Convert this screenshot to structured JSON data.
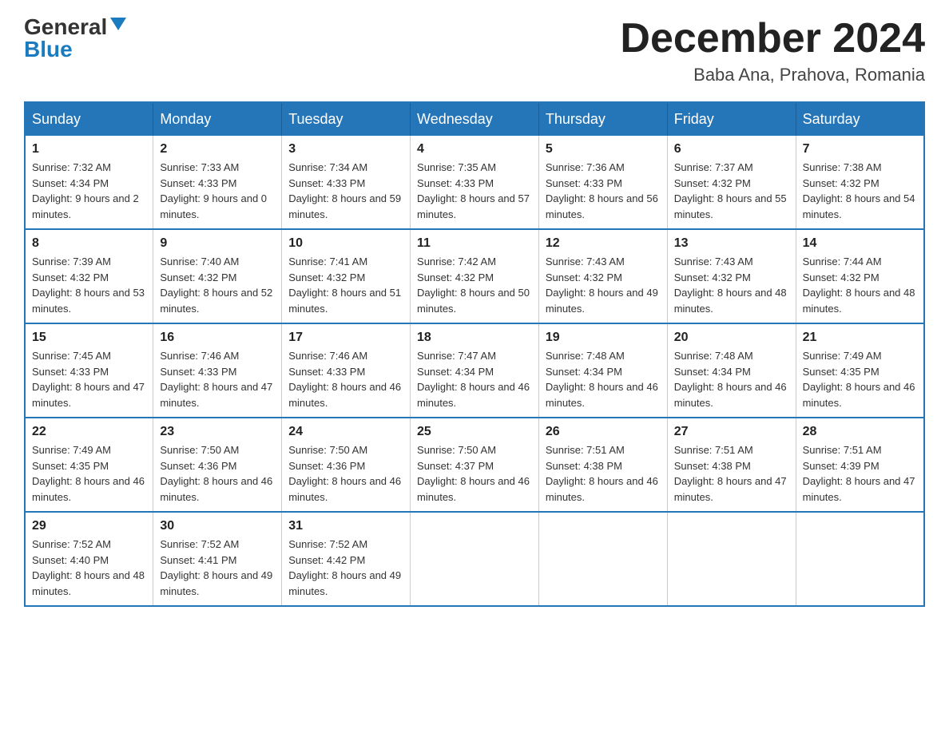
{
  "header": {
    "logo": {
      "general": "General",
      "blue": "Blue"
    },
    "title": "December 2024",
    "location": "Baba Ana, Prahova, Romania"
  },
  "calendar": {
    "headers": [
      "Sunday",
      "Monday",
      "Tuesday",
      "Wednesday",
      "Thursday",
      "Friday",
      "Saturday"
    ],
    "weeks": [
      [
        {
          "day": "1",
          "sunrise": "7:32 AM",
          "sunset": "4:34 PM",
          "daylight": "9 hours and 2 minutes."
        },
        {
          "day": "2",
          "sunrise": "7:33 AM",
          "sunset": "4:33 PM",
          "daylight": "9 hours and 0 minutes."
        },
        {
          "day": "3",
          "sunrise": "7:34 AM",
          "sunset": "4:33 PM",
          "daylight": "8 hours and 59 minutes."
        },
        {
          "day": "4",
          "sunrise": "7:35 AM",
          "sunset": "4:33 PM",
          "daylight": "8 hours and 57 minutes."
        },
        {
          "day": "5",
          "sunrise": "7:36 AM",
          "sunset": "4:33 PM",
          "daylight": "8 hours and 56 minutes."
        },
        {
          "day": "6",
          "sunrise": "7:37 AM",
          "sunset": "4:32 PM",
          "daylight": "8 hours and 55 minutes."
        },
        {
          "day": "7",
          "sunrise": "7:38 AM",
          "sunset": "4:32 PM",
          "daylight": "8 hours and 54 minutes."
        }
      ],
      [
        {
          "day": "8",
          "sunrise": "7:39 AM",
          "sunset": "4:32 PM",
          "daylight": "8 hours and 53 minutes."
        },
        {
          "day": "9",
          "sunrise": "7:40 AM",
          "sunset": "4:32 PM",
          "daylight": "8 hours and 52 minutes."
        },
        {
          "day": "10",
          "sunrise": "7:41 AM",
          "sunset": "4:32 PM",
          "daylight": "8 hours and 51 minutes."
        },
        {
          "day": "11",
          "sunrise": "7:42 AM",
          "sunset": "4:32 PM",
          "daylight": "8 hours and 50 minutes."
        },
        {
          "day": "12",
          "sunrise": "7:43 AM",
          "sunset": "4:32 PM",
          "daylight": "8 hours and 49 minutes."
        },
        {
          "day": "13",
          "sunrise": "7:43 AM",
          "sunset": "4:32 PM",
          "daylight": "8 hours and 48 minutes."
        },
        {
          "day": "14",
          "sunrise": "7:44 AM",
          "sunset": "4:32 PM",
          "daylight": "8 hours and 48 minutes."
        }
      ],
      [
        {
          "day": "15",
          "sunrise": "7:45 AM",
          "sunset": "4:33 PM",
          "daylight": "8 hours and 47 minutes."
        },
        {
          "day": "16",
          "sunrise": "7:46 AM",
          "sunset": "4:33 PM",
          "daylight": "8 hours and 47 minutes."
        },
        {
          "day": "17",
          "sunrise": "7:46 AM",
          "sunset": "4:33 PM",
          "daylight": "8 hours and 46 minutes."
        },
        {
          "day": "18",
          "sunrise": "7:47 AM",
          "sunset": "4:34 PM",
          "daylight": "8 hours and 46 minutes."
        },
        {
          "day": "19",
          "sunrise": "7:48 AM",
          "sunset": "4:34 PM",
          "daylight": "8 hours and 46 minutes."
        },
        {
          "day": "20",
          "sunrise": "7:48 AM",
          "sunset": "4:34 PM",
          "daylight": "8 hours and 46 minutes."
        },
        {
          "day": "21",
          "sunrise": "7:49 AM",
          "sunset": "4:35 PM",
          "daylight": "8 hours and 46 minutes."
        }
      ],
      [
        {
          "day": "22",
          "sunrise": "7:49 AM",
          "sunset": "4:35 PM",
          "daylight": "8 hours and 46 minutes."
        },
        {
          "day": "23",
          "sunrise": "7:50 AM",
          "sunset": "4:36 PM",
          "daylight": "8 hours and 46 minutes."
        },
        {
          "day": "24",
          "sunrise": "7:50 AM",
          "sunset": "4:36 PM",
          "daylight": "8 hours and 46 minutes."
        },
        {
          "day": "25",
          "sunrise": "7:50 AM",
          "sunset": "4:37 PM",
          "daylight": "8 hours and 46 minutes."
        },
        {
          "day": "26",
          "sunrise": "7:51 AM",
          "sunset": "4:38 PM",
          "daylight": "8 hours and 46 minutes."
        },
        {
          "day": "27",
          "sunrise": "7:51 AM",
          "sunset": "4:38 PM",
          "daylight": "8 hours and 47 minutes."
        },
        {
          "day": "28",
          "sunrise": "7:51 AM",
          "sunset": "4:39 PM",
          "daylight": "8 hours and 47 minutes."
        }
      ],
      [
        {
          "day": "29",
          "sunrise": "7:52 AM",
          "sunset": "4:40 PM",
          "daylight": "8 hours and 48 minutes."
        },
        {
          "day": "30",
          "sunrise": "7:52 AM",
          "sunset": "4:41 PM",
          "daylight": "8 hours and 49 minutes."
        },
        {
          "day": "31",
          "sunrise": "7:52 AM",
          "sunset": "4:42 PM",
          "daylight": "8 hours and 49 minutes."
        },
        null,
        null,
        null,
        null
      ]
    ]
  }
}
